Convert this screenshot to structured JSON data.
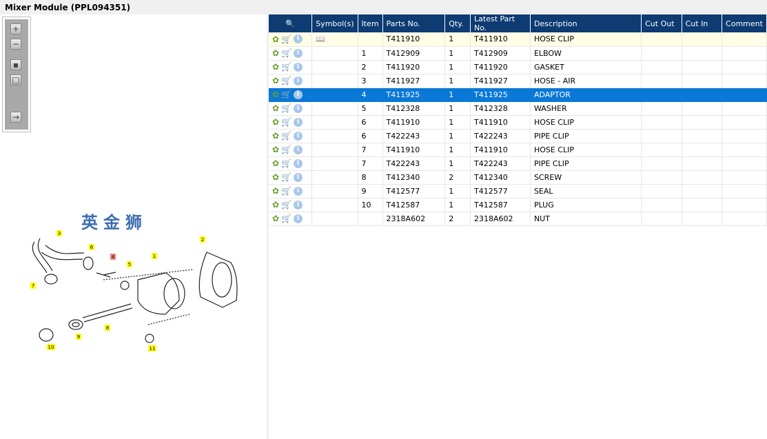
{
  "title": "Mixer Module (PPL094351)",
  "toolbar": [
    "zoom-in",
    "zoom-out",
    "fit-all",
    "actual-size",
    "toggle-list"
  ],
  "columns": [
    "",
    "Symbol(s)",
    "Item",
    "Parts No.",
    "Qty.",
    "Latest Part No.",
    "Description",
    "Cut Out",
    "Cut In",
    "Comment"
  ],
  "rows": [
    {
      "item": "",
      "part": "T411910",
      "qty": "1",
      "latest": "T411910",
      "desc": "HOSE CLIP",
      "symbol": true
    },
    {
      "item": "1",
      "part": "T412909",
      "qty": "1",
      "latest": "T412909",
      "desc": "ELBOW"
    },
    {
      "item": "2",
      "part": "T411920",
      "qty": "1",
      "latest": "T411920",
      "desc": "GASKET"
    },
    {
      "item": "3",
      "part": "T411927",
      "qty": "1",
      "latest": "T411927",
      "desc": "HOSE - AIR"
    },
    {
      "item": "4",
      "part": "T411925",
      "qty": "1",
      "latest": "T411925",
      "desc": "ADAPTOR",
      "selected": true
    },
    {
      "item": "5",
      "part": "T412328",
      "qty": "1",
      "latest": "T412328",
      "desc": "WASHER"
    },
    {
      "item": "6",
      "part": "T411910",
      "qty": "1",
      "latest": "T411910",
      "desc": "HOSE CLIP"
    },
    {
      "item": "6",
      "part": "T422243",
      "qty": "1",
      "latest": "T422243",
      "desc": "PIPE CLIP"
    },
    {
      "item": "7",
      "part": "T411910",
      "qty": "1",
      "latest": "T411910",
      "desc": "HOSE CLIP"
    },
    {
      "item": "7",
      "part": "T422243",
      "qty": "1",
      "latest": "T422243",
      "desc": "PIPE CLIP"
    },
    {
      "item": "8",
      "part": "T412340",
      "qty": "2",
      "latest": "T412340",
      "desc": "SCREW"
    },
    {
      "item": "9",
      "part": "T412577",
      "qty": "1",
      "latest": "T412577",
      "desc": "SEAL"
    },
    {
      "item": "10",
      "part": "T412587",
      "qty": "1",
      "latest": "T412587",
      "desc": "PLUG"
    },
    {
      "item": "",
      "part": "2318A602",
      "qty": "2",
      "latest": "2318A602",
      "desc": "NUT"
    }
  ],
  "watermark": "英金狮",
  "callouts": [
    {
      "label": "3",
      "highlight": false
    },
    {
      "label": "6",
      "highlight": false
    },
    {
      "label": "4",
      "highlight": true
    },
    {
      "label": "5",
      "highlight": false
    },
    {
      "label": "1",
      "highlight": false
    },
    {
      "label": "2",
      "highlight": false
    },
    {
      "label": "7",
      "highlight": false
    },
    {
      "label": "8",
      "highlight": false
    },
    {
      "label": "9",
      "highlight": false
    },
    {
      "label": "10",
      "highlight": false
    },
    {
      "label": "11",
      "highlight": false
    }
  ],
  "colors": {
    "header": "#0d3b72",
    "selected": "#0a78d7",
    "callout": "#ffff00",
    "callout_selected": "#f08080"
  }
}
